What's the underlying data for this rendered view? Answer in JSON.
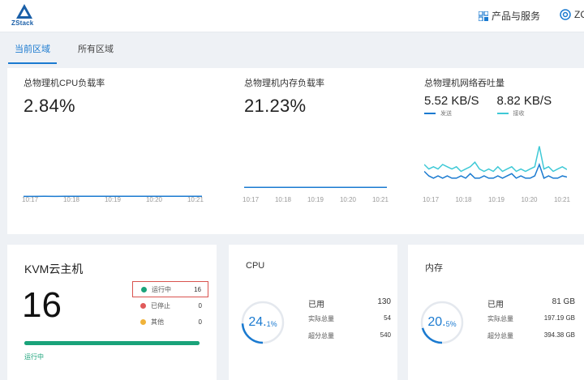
{
  "header": {
    "logo_text": "ZStack",
    "products_label": "产品与服务",
    "user_label": "ZC"
  },
  "region_tabs": [
    {
      "label": "当前区域",
      "active": true
    },
    {
      "label": "所有区域",
      "active": false
    }
  ],
  "metrics": {
    "cpu": {
      "title": "总物理机CPU负载率",
      "value": "2.84%",
      "x_labels": [
        "10:17",
        "10:18",
        "10:19",
        "10:20",
        "10:21"
      ],
      "series": [
        2.6,
        2.7,
        2.8,
        2.7,
        2.8,
        2.9,
        2.8,
        2.9,
        2.8,
        2.9,
        2.8,
        2.9,
        2.8,
        2.9,
        2.8,
        2.9,
        2.8,
        2.84
      ],
      "color": "#1a7ad0"
    },
    "memory": {
      "title": "总物理机内存负载率",
      "value": "21.23%",
      "x_labels": [
        "10:17",
        "10:18",
        "10:19",
        "10:20",
        "10:21"
      ],
      "series": [
        21.23,
        21.23,
        21.23,
        21.23,
        21.23,
        21.23,
        21.23,
        21.23
      ],
      "color": "#1a7ad0"
    },
    "network": {
      "title": "总物理机网络吞吐量",
      "send_value": "5.52 KB/S",
      "send_label": "发送",
      "send_color": "#1a7ad0",
      "recv_value": "8.82 KB/S",
      "recv_label": "接收",
      "recv_color": "#3ec9d6",
      "x_labels": [
        "10:17",
        "10:18",
        "10:19",
        "10:20",
        "10:21"
      ],
      "send_series": [
        8,
        6,
        5,
        6,
        5,
        6,
        5,
        5,
        6,
        5,
        7,
        5,
        5,
        6,
        5,
        5,
        6,
        5,
        6,
        7,
        5,
        6,
        5,
        5,
        6,
        11,
        5,
        6,
        5,
        5,
        6,
        5.5
      ],
      "recv_series": [
        11,
        9,
        10,
        9,
        11,
        10,
        9,
        10,
        8,
        9,
        10,
        12,
        9,
        8,
        9,
        8,
        10,
        8,
        9,
        10,
        8,
        9,
        8,
        9,
        10,
        19,
        9,
        10,
        8,
        9,
        10,
        8.8
      ]
    }
  },
  "kvm": {
    "title": "KVM云主机",
    "total": "16",
    "statuses": [
      {
        "label": "运行中",
        "count": "16",
        "color": "#1aa37a",
        "highlight": true
      },
      {
        "label": "已停止",
        "count": "0",
        "color": "#e05a5a",
        "highlight": false
      },
      {
        "label": "其他",
        "count": "0",
        "color": "#f0b33a",
        "highlight": false
      }
    ],
    "running_fraction": 1.0,
    "bar_label": "运行中"
  },
  "cpu_card": {
    "title": "CPU",
    "percent_main": "24.",
    "percent_suffix": "1%",
    "percent_value": 24.1,
    "used_label": "已用",
    "used_value": "130",
    "actual_label": "实际总量",
    "actual_value": "54",
    "overcommit_label": "超分总量",
    "overcommit_value": "540"
  },
  "mem_card": {
    "title": "内存",
    "percent_main": "20.",
    "percent_suffix": "5%",
    "percent_value": 20.5,
    "used_label": "已用",
    "used_value": "81 GB",
    "actual_label": "实际总量",
    "actual_value": "197.19 GB",
    "overcommit_label": "超分总量",
    "overcommit_value": "394.38 GB"
  },
  "colors": {
    "accent": "#1a7ad0",
    "running": "#1aa37a",
    "stopped": "#e05a5a",
    "other": "#f0b33a",
    "gauge_track": "#e4e8ee"
  }
}
